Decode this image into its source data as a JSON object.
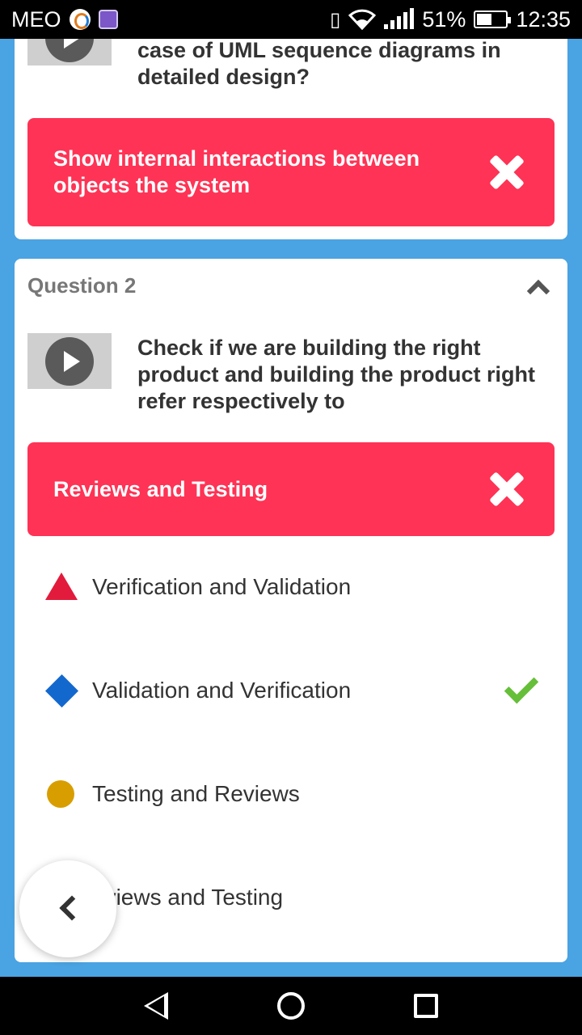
{
  "status_bar": {
    "carrier": "MEO",
    "battery": "51%",
    "time": "12:35",
    "icons": [
      "app-icon",
      "image-icon",
      "vibrate-icon",
      "wifi-icon",
      "signal-icon",
      "battery-icon"
    ]
  },
  "card1": {
    "question_text": "case of UML sequence diagrams in detailed design?",
    "answer": "Show internal interactions between objects the system"
  },
  "card2": {
    "header": "Question 2",
    "question_text": "Check if we are building the right product and building the product right refer respectively to",
    "answer": "Reviews and Testing",
    "options": [
      {
        "label": "Verification and Validation",
        "shape": "triangle",
        "color": "#e21b3c"
      },
      {
        "label": "Validation and Verification",
        "shape": "diamond",
        "color": "#1368ce",
        "correct": true
      },
      {
        "label": "Testing and Reviews",
        "shape": "circle",
        "color": "#d89e00"
      },
      {
        "label": "eviews and Testing",
        "shape": "square",
        "color": "#26890c"
      }
    ]
  },
  "colors": {
    "background": "#4aa3e2",
    "wrong_answer": "#ff3355",
    "correct_check": "#66bf39"
  }
}
